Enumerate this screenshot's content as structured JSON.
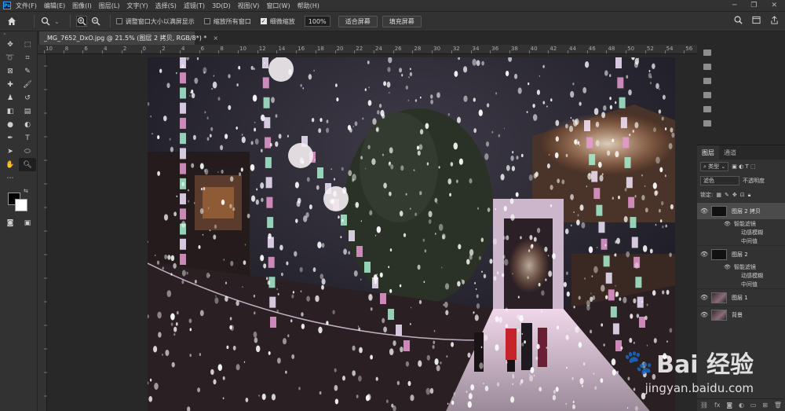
{
  "menu": {
    "items": [
      "文件(F)",
      "编辑(E)",
      "图像(I)",
      "图层(L)",
      "文字(Y)",
      "选择(S)",
      "滤镜(T)",
      "3D(D)",
      "视图(V)",
      "窗口(W)",
      "帮助(H)"
    ]
  },
  "options": {
    "resize_windows_label": "调整窗口大小以满屏显示",
    "zoom_all_label": "缩放所有窗口",
    "scrubby_zoom_label": "细微缩放",
    "zoom_value": "100%",
    "fit_screen_label": "适合屏幕",
    "fill_screen_label": "填充屏幕"
  },
  "document": {
    "tab_title": "_MG_7652_DxO.jpg @ 21.5% (图层 2 拷贝, RGB/8*) *",
    "tab_close": "×"
  },
  "ruler": {
    "ticks": [
      "10",
      "8",
      "6",
      "4",
      "2",
      "0",
      "2",
      "4",
      "6",
      "8",
      "10",
      "12",
      "14",
      "16",
      "18",
      "20",
      "22",
      "24",
      "26",
      "28",
      "30",
      "32",
      "34",
      "36",
      "38",
      "40",
      "42",
      "44",
      "46",
      "48",
      "50",
      "52",
      "54",
      "56"
    ]
  },
  "layers_panel": {
    "tabs": [
      "图层",
      "通道"
    ],
    "filter_kind": "类型",
    "blend_mode": "滤色",
    "opacity_label": "不透明度",
    "lock_label": "锁定:",
    "layers": [
      {
        "name": "图层 2 拷贝",
        "selected": true,
        "thumb": "dark",
        "smart_filters": "智能滤镜",
        "filters": [
          "动感模糊",
          "中间值"
        ]
      },
      {
        "name": "图层 2",
        "selected": false,
        "thumb": "dark",
        "smart_filters": "智能滤镜",
        "filters": [
          "动感模糊",
          "中间值"
        ]
      },
      {
        "name": "图层 1",
        "selected": false,
        "thumb": "photo"
      },
      {
        "name": "背景",
        "selected": false,
        "thumb": "photo"
      }
    ],
    "footer_icons": [
      "link-icon",
      "fx-icon",
      "mask-icon",
      "adjustment-icon",
      "group-icon",
      "new-layer-icon",
      "trash-icon"
    ]
  },
  "watermark": {
    "brand": "Bai 经验",
    "url": "jingyan.baidu.com"
  },
  "colors": {
    "accent": "#31a8ff",
    "panel_bg": "#323232",
    "workspace_bg": "#282828"
  }
}
